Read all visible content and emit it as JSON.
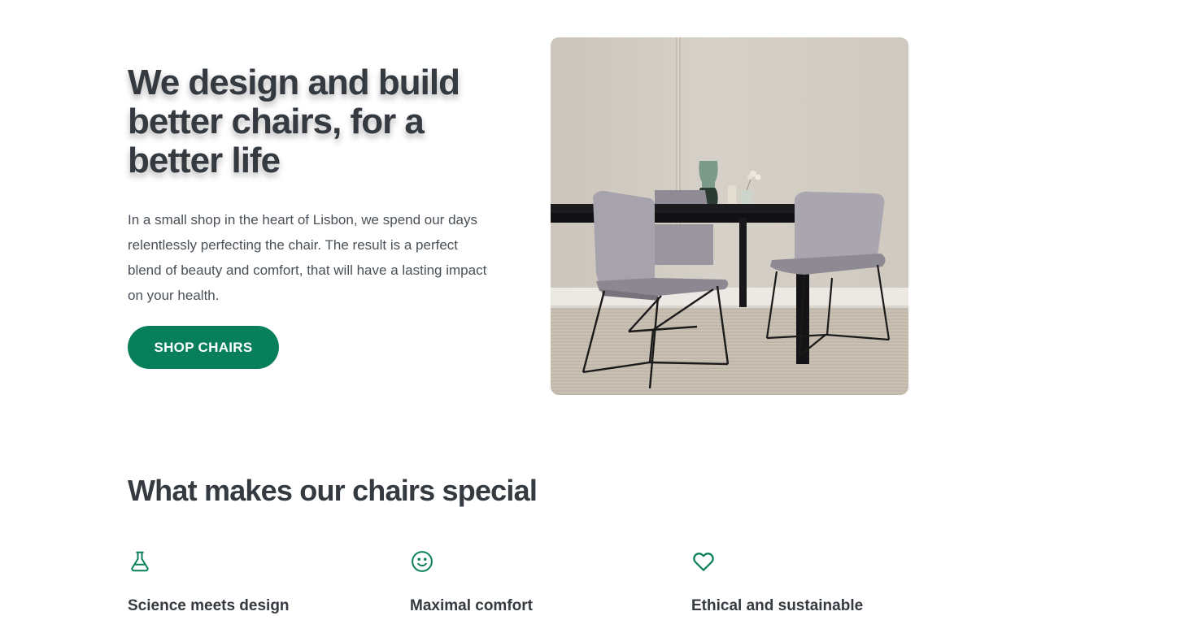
{
  "hero": {
    "title": "We design and build better chairs, for a better life",
    "text": "In a small shop in the heart of Lisbon, we spend our days relentlessly perfecting the chair. The result is a perfect blend of beauty and comfort, that will have a lasting impact on your health.",
    "cta_label": "SHOP CHAIRS",
    "image": "dining-table-with-chairs-photo"
  },
  "features": {
    "title": "What makes our chairs special",
    "items": [
      {
        "icon": "flask-icon",
        "title": "Science meets design"
      },
      {
        "icon": "smiley-icon",
        "title": "Maximal comfort"
      },
      {
        "icon": "heart-icon",
        "title": "Ethical and sustainable"
      }
    ]
  },
  "colors": {
    "accent": "#087f5b",
    "text": "#343a40",
    "body_text": "#495057",
    "background": "#ffffff"
  }
}
